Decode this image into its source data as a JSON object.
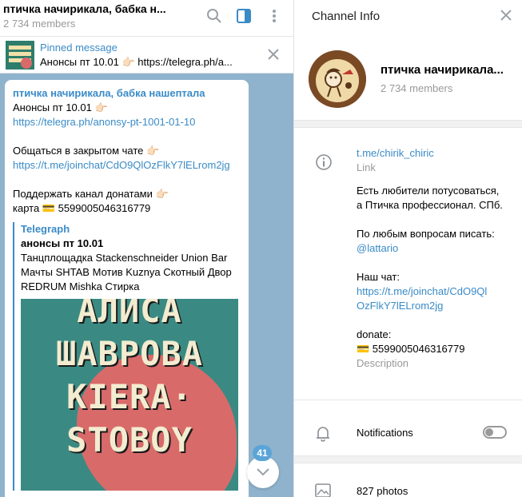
{
  "chat": {
    "title": "птичка начирикала, бабка н...",
    "members": "2 734 members"
  },
  "pinned": {
    "title": "Pinned message",
    "text": "Анонсы пт 10.01 👉🏻 https://telegra.ph/a..."
  },
  "message": {
    "author": "птичка начирикала, бабка нашептала",
    "line1": "Анонсы пт 10.01 👉🏻",
    "link1": "https://telegra.ph/anonsy-pt-1001-01-10",
    "line2": "Общаться в закрытом чате 👉🏻",
    "link2": "https://t.me/joinchat/CdO9QlOzFlkY7lELrom2jg",
    "line3": "Поддержать канал донатами 👉🏻",
    "line4": "карта 💳 5599005046316779",
    "preview": {
      "site": "Telegraph",
      "title": "анонсы пт 10.01",
      "desc": "Танцплощадка Stackenschneider Union Bar Мачты SHTAB Мотив Kuznya Скотный Двор REDRUM Mishka Стирка",
      "image_words": [
        "АЛИСА",
        "ШАВРОВА",
        "KIERA·",
        "STOBOY"
      ]
    }
  },
  "unread_badge": "41",
  "info": {
    "header_title": "Channel Info",
    "name": "птичка начирикала...",
    "members": "2 734 members",
    "link": "t.me/chirik_chiric",
    "link_caption": "Link",
    "desc_l1": "Есть любители потусоваться,",
    "desc_l2": "а Птичка профессионал. СПб.",
    "desc_l3": "По любым вопросам писать:",
    "desc_handle": "@lattario",
    "desc_l4": "Наш чат:",
    "desc_link_a": "https://t.me/joinchat/CdO9Ql",
    "desc_link_b": "OzFlkY7lELrom2jg",
    "desc_l5": "donate:",
    "desc_card": "💳 5599005046316779",
    "desc_caption": "Description",
    "notifications": "Notifications",
    "photos": "827 photos"
  },
  "colors": {
    "accent": "#3a8bc7",
    "chat_bg": "#8fb3cc",
    "badge": "#5ba4d8"
  }
}
